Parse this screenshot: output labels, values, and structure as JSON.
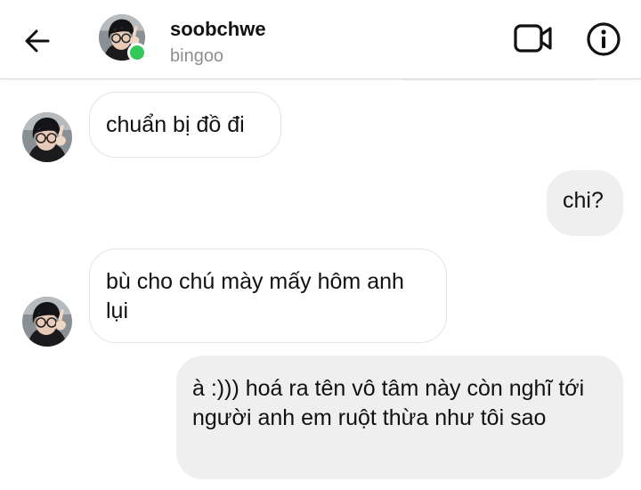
{
  "header": {
    "username": "soobchwe",
    "subname": "bingoo"
  },
  "icons": {
    "back": "arrow-left-icon",
    "video": "video-camera-icon",
    "info": "info-icon"
  },
  "colors": {
    "online": "#34c759",
    "outgoing_bubble": "#efefef",
    "incoming_border": "#e3e3e3",
    "secondary_text": "#8e8e8e"
  },
  "messages": [
    {
      "direction": "incoming",
      "text": "chuẩn bị đồ đi"
    },
    {
      "direction": "outgoing",
      "text": "chi?"
    },
    {
      "direction": "incoming",
      "text": "bù cho chú mày mấy hôm anh lụi"
    },
    {
      "direction": "outgoing",
      "text": "à :))) hoá ra tên vô tâm này còn nghĩ tới người anh em ruột thừa như tôi sao"
    }
  ]
}
